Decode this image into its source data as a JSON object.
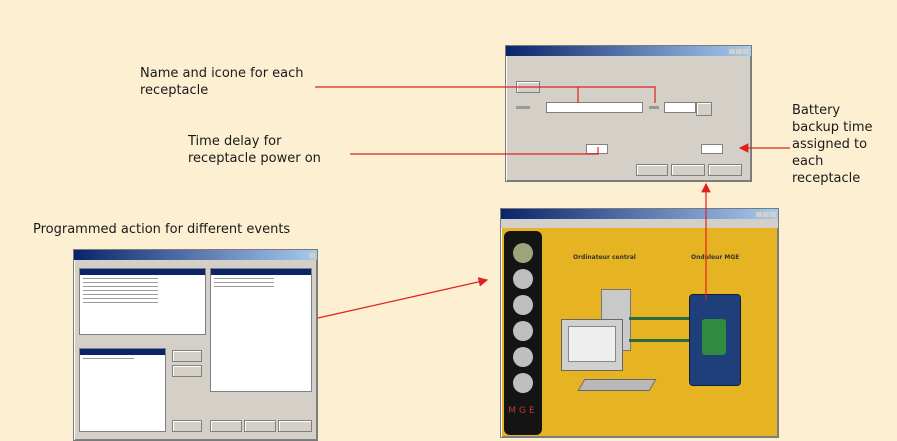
{
  "callouts": {
    "name_icon_line1": "Name and icone for each",
    "name_icon_line2": "receptacle",
    "time_delay_line1": "Time delay for",
    "time_delay_line2": "receptacle power on",
    "battery_line1": "Battery",
    "battery_line2": "backup time",
    "battery_line3": "assigned to",
    "battery_line4": "each",
    "battery_line5": "receptacle",
    "programmed_action": "Programmed action for different events"
  },
  "main_app": {
    "label_left": "Ordinateur central",
    "label_right": "Onduleur MGE",
    "brand_letters": [
      "M",
      "G",
      "E"
    ]
  },
  "colors": {
    "background": "#fdf0d2",
    "arrow": "#e0201f",
    "window_face": "#d4d0c8",
    "title_blue": "#0a246a",
    "app_yellow": "#e6b422"
  }
}
